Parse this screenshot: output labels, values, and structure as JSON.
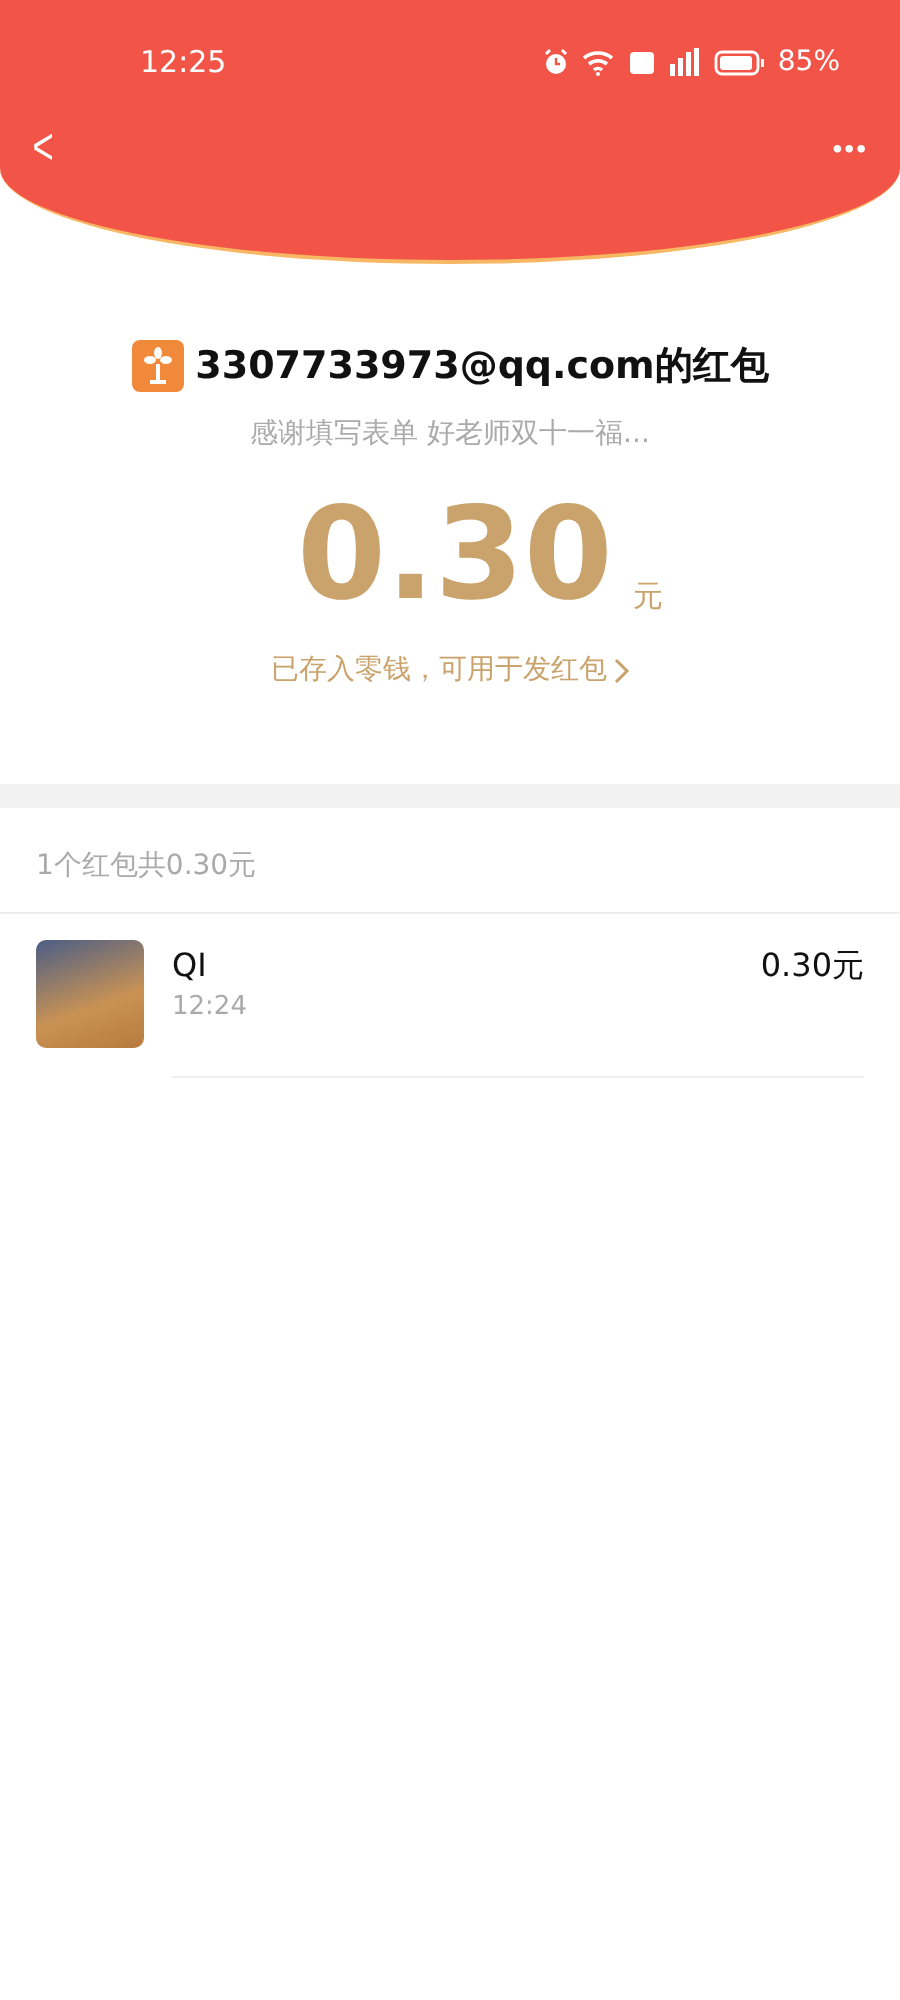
{
  "status_bar": {
    "time": "12:25",
    "battery": "85%"
  },
  "header": {
    "back": "<",
    "more": "•••"
  },
  "packet": {
    "title": "3307733973@qq.com的红包",
    "message": "感谢填写表单 好老师双十一福...",
    "amount": "0.30",
    "unit": "元",
    "note": "已存入零钱，可用于发红包"
  },
  "summary": "1个红包共0.30元",
  "receivers": [
    {
      "name": "QI",
      "time": "12:24",
      "amount": "0.30元"
    }
  ]
}
